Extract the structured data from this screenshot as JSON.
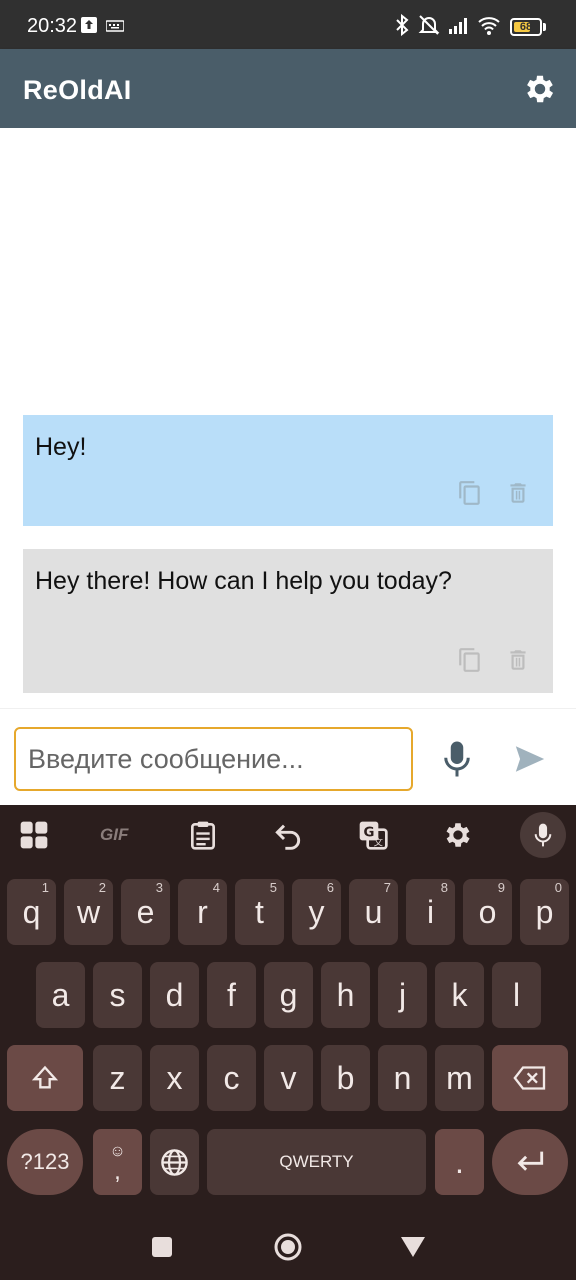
{
  "status_bar": {
    "time": "20:32",
    "battery_percent": 68,
    "battery_label": "68"
  },
  "app": {
    "title": "ReOldAI"
  },
  "messages": [
    {
      "role": "user",
      "text": "Hey!"
    },
    {
      "role": "assistant",
      "text": "Hey there! How can I help you today?"
    }
  ],
  "input": {
    "placeholder": "Введите сообщение...",
    "value": ""
  },
  "keyboard": {
    "row1": [
      {
        "label": "q",
        "hint": "1"
      },
      {
        "label": "w",
        "hint": "2"
      },
      {
        "label": "e",
        "hint": "3"
      },
      {
        "label": "r",
        "hint": "4"
      },
      {
        "label": "t",
        "hint": "5"
      },
      {
        "label": "y",
        "hint": "6"
      },
      {
        "label": "u",
        "hint": "7"
      },
      {
        "label": "i",
        "hint": "8"
      },
      {
        "label": "o",
        "hint": "9"
      },
      {
        "label": "p",
        "hint": "0"
      }
    ],
    "row2": [
      "a",
      "s",
      "d",
      "f",
      "g",
      "h",
      "j",
      "k",
      "l"
    ],
    "row3": [
      "z",
      "x",
      "c",
      "v",
      "b",
      "n",
      "m"
    ],
    "symbols_label": "?123",
    "emoji_comma_label": ",",
    "space_label": "QWERTY",
    "period_label": ".",
    "toolbar_gif_label": "GIF"
  },
  "colors": {
    "appbar": "#4a5d69",
    "user_bubble": "#b9def9",
    "assistant_bubble": "#e0e0e0",
    "input_border": "#e6a82c",
    "keyboard_bg": "#2b1e1d"
  }
}
